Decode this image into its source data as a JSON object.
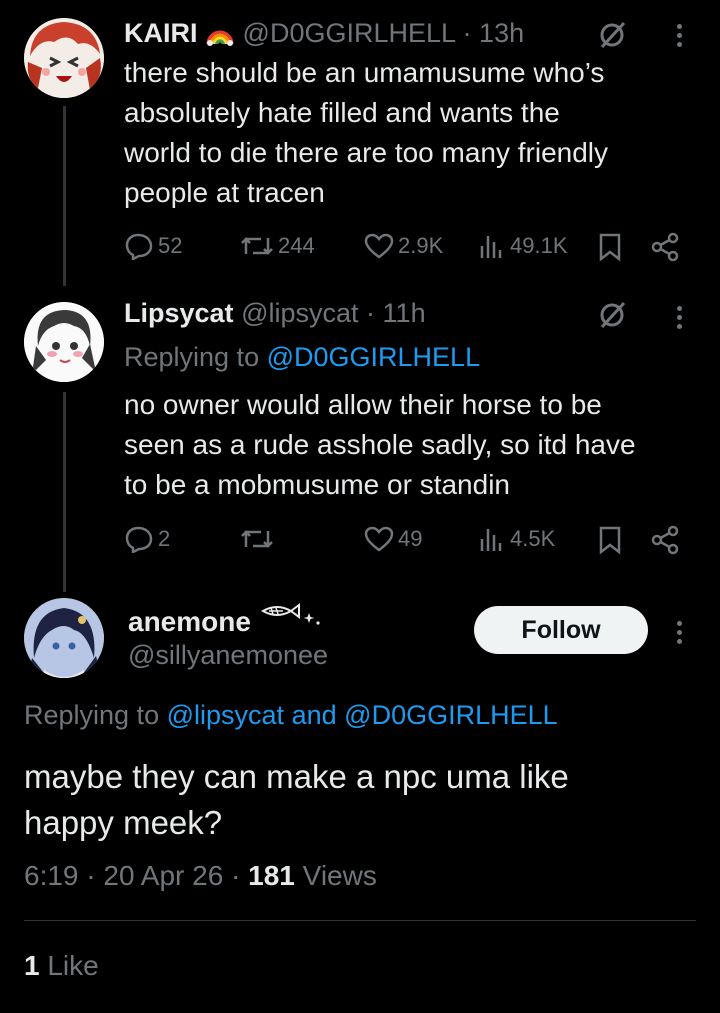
{
  "tweets": [
    {
      "display_name": "KAIRI",
      "handle": "@D0GGIRLHELL",
      "time": "13h",
      "lines": [
        "there should be an umamusume who’s",
        "absolutely hate filled and wants the",
        "world to die there are too many friendly",
        "people at tracen"
      ],
      "stats": {
        "replies": "52",
        "reposts": "244",
        "likes": "2.9K",
        "views": "49.1K"
      }
    },
    {
      "display_name": "Lipsycat",
      "handle": "@lipsycat",
      "time": "11h",
      "replying_prefix": "Replying to",
      "replying_to": "@D0GGIRLHELL",
      "lines": [
        "no owner would allow their horse to be",
        "seen as a rude asshole sadly, so itd have",
        "to be a mobmusume or standin"
      ],
      "stats": {
        "replies": "2",
        "reposts": "",
        "likes": "49",
        "views": "4.5K"
      }
    }
  ],
  "main_tweet": {
    "display_name": "anemone",
    "handle": "@sillyanemonee",
    "follow_label": "Follow",
    "replying_prefix": "Replying to",
    "replying_to_1": "@lipsycat",
    "replying_and": "and",
    "replying_to_2": "@D0GGIRLHELL",
    "lines": [
      "maybe they can make a npc uma like",
      "happy meek?"
    ],
    "time": "6:19",
    "date": "20 Apr 26",
    "views_count": "181",
    "views_label": "Views",
    "likes_count": "1",
    "likes_label": "Like"
  },
  "colors": {
    "background": "#000000",
    "text": "#e7e9ea",
    "secondary": "#71767b",
    "link": "#1d9bf0"
  }
}
